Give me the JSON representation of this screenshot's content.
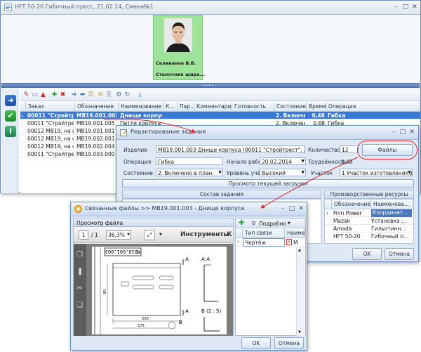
{
  "main_window": {
    "title": "HFT 50-20 Гибочный пресс, 21.02.14, Смена№1",
    "operator": {
      "name": "Селиванов В.В.",
      "role": "Станочник широ..."
    },
    "grid": {
      "columns": [
        "Заказ",
        "Обозначение",
        "Наименование",
        "К...",
        "Пар...",
        "Комментарий",
        "Готовность",
        "Состояние",
        "Время",
        "Операция"
      ],
      "rows": [
        {
          "order": "00011 \"Стройтрест\"...",
          "code": "МВ19.001.003",
          "name": "Днище корпуса",
          "state": "2. Включено...",
          "time": "0,48",
          "op": "Гибка",
          "selected": true
        },
        {
          "order": "00011 \"Стройтрест\"...",
          "code": "МВ19.001.005",
          "name": "Петля корпуса",
          "state": "2. Включено...",
          "time": "0,68",
          "op": "Гибка",
          "selected": false
        },
        {
          "order": "00012 МВ19, на склад",
          "code": "МВ19.001.001",
          "name": "",
          "state": "",
          "time": "",
          "op": "",
          "selected": false
        },
        {
          "order": "00012 МВ19, на склад",
          "code": "МВ19.002.001",
          "name": "",
          "state": "",
          "time": "",
          "op": "",
          "selected": false
        },
        {
          "order": "00012 МВ19, на склад",
          "code": "МВ19.002.004",
          "name": "",
          "state": "",
          "time": "",
          "op": "",
          "selected": false
        },
        {
          "order": "00011 \"Стройтрест\"...",
          "code": "МВ19.003.000",
          "name": "",
          "state": "",
          "time": "",
          "op": "",
          "selected": false
        }
      ]
    }
  },
  "edit_dialog": {
    "title": "Редактирование задания",
    "labels": {
      "item": "Изделие",
      "operation": "Операция",
      "state": "Состояние",
      "start": "Начало работ",
      "account_level": "Уровень учёта",
      "qty": "Количество",
      "labor": "Трудоёмкость",
      "section": "Участок"
    },
    "values": {
      "item": "МВ19.001.003 Днище корпуса (00011 \"Стройтрест\", договор №126, 0001",
      "operation": "Гибка",
      "state": "2. Включено в план.",
      "start": "20.02.2014",
      "account_level": "Высокий",
      "qty": "12",
      "labor": "0,48",
      "section": "1 Участок изготовления дет..."
    },
    "files_button": "Файлы",
    "load_view_button": "Просмотр текущей загрузки",
    "composition_header": "Состав задания",
    "resources_header": "Производственные ресурсы участка",
    "resources": {
      "columns": [
        "Обозначение",
        "Наименова..."
      ],
      "rows": [
        {
          "code": "Finn Power",
          "name": "Координат..."
        },
        {
          "code": "Mazak",
          "name": "Установка ..."
        },
        {
          "code": "Amada",
          "name": "Гильотинн..."
        },
        {
          "code": "HFT 50-20",
          "name": "Гибочный п..."
        }
      ]
    },
    "ok": "OK",
    "cancel": "Отмена"
  },
  "files_dialog": {
    "title": "Связанные файлы >> МВ19.001.003 - Днище корпуса",
    "preview_title": "Просмотр файла",
    "page_current": "1",
    "page_total": "/ 1",
    "zoom": "36,3%",
    "tools_label": "Инструменты",
    "tools_cut": "К",
    "detail_button": "Подробно",
    "columns": [
      "Тип связи",
      "Наимен"
    ],
    "rows": [
      {
        "type": "Чертёж",
        "name": "М"
      }
    ],
    "drawing": {
      "stamp": "МВ19.001.003",
      "label_a": "А",
      "section_aa": "А-А",
      "section_b": "В (2 : 5)",
      "label_b": "В",
      "dim_200": "200",
      "dim_80": "80",
      "dim_175": "175"
    },
    "ok": "OK",
    "cancel": "Отмена"
  },
  "colors": {
    "selection": "#3a78d6",
    "accent_red": "#e0282c",
    "active_cell": "#4a76c0",
    "operator_bg": "#9ee39a"
  }
}
